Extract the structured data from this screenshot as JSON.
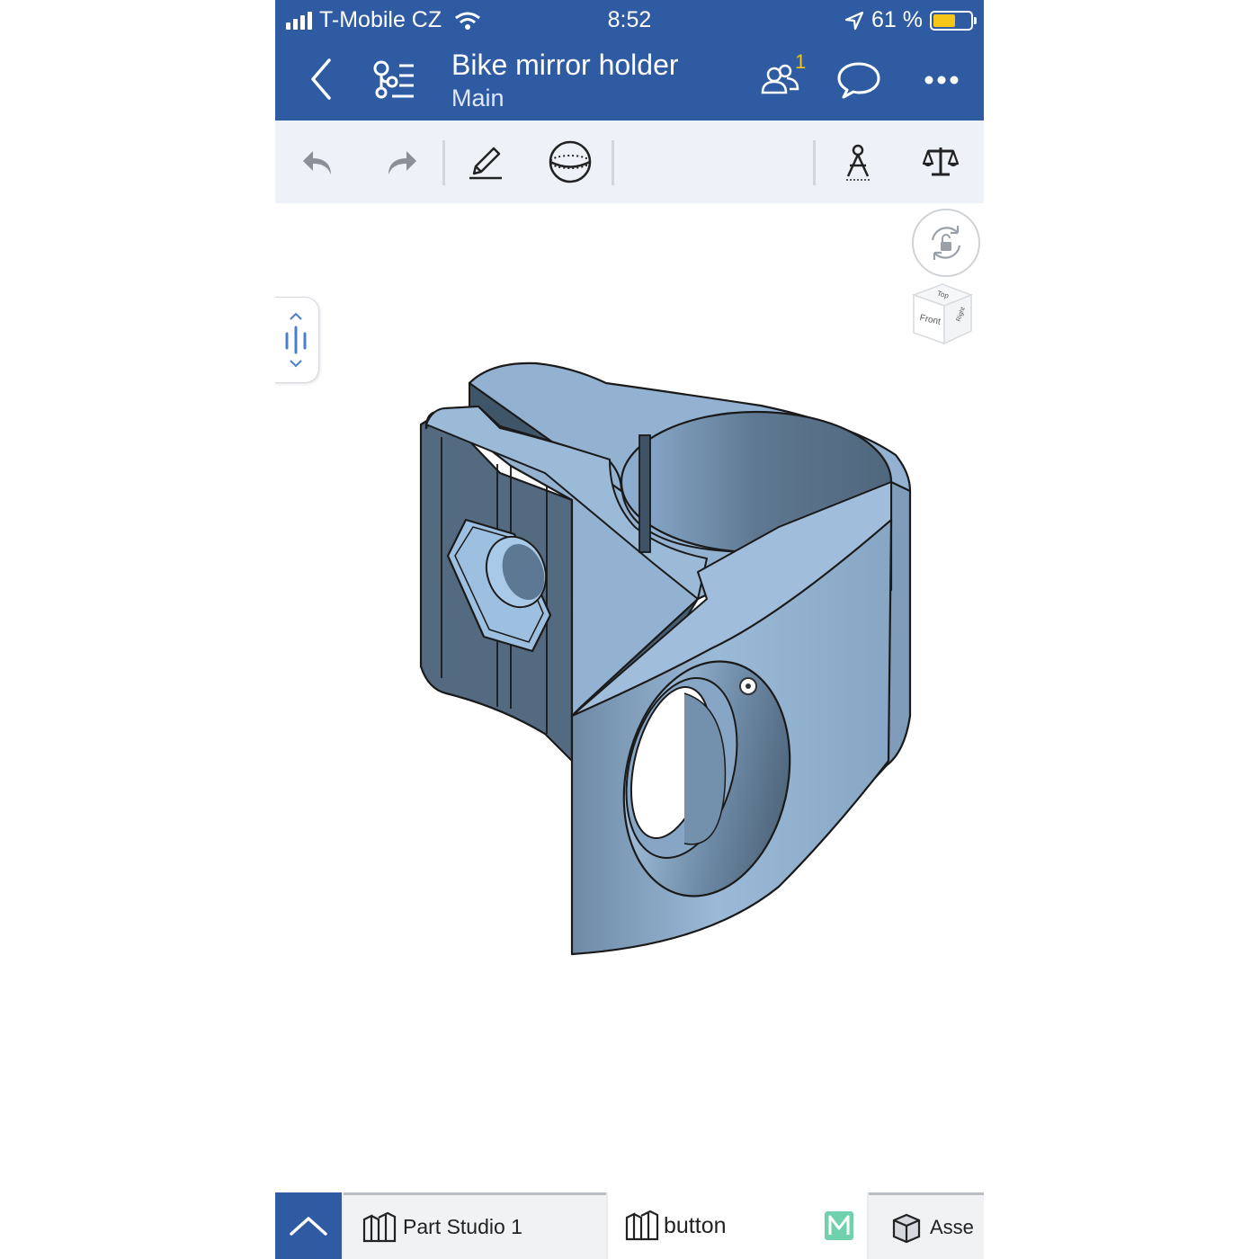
{
  "status_bar": {
    "carrier": "T-Mobile CZ",
    "time": "8:52",
    "battery_percent": "61 %",
    "battery_level": 0.61
  },
  "header": {
    "title": "Bike mirror holder",
    "subtitle": "Main",
    "collaborators_count": "1",
    "back_icon": "chevron-left-icon",
    "feature_tree_icon": "feature-tree-icon",
    "comments_icon": "comment-icon",
    "more_icon": "more-icon"
  },
  "toolbar": {
    "undo_icon": "undo-icon",
    "redo_icon": "redo-icon",
    "sketch_icon": "pencil-icon",
    "view_icon": "sphere-icon",
    "measure_icon": "compass-icon",
    "mass_icon": "scales-icon"
  },
  "viewcube": {
    "front_label": "Front",
    "top_label": "Top",
    "right_label": "Right"
  },
  "tabs": [
    {
      "label": "Part Studio 1",
      "selected": true
    },
    {
      "label": "button",
      "selected": false
    },
    {
      "label": "Asse",
      "selected": false
    }
  ],
  "colors": {
    "brand_blue": "#2f5ba3",
    "model_blue": "#8fb1d3"
  }
}
